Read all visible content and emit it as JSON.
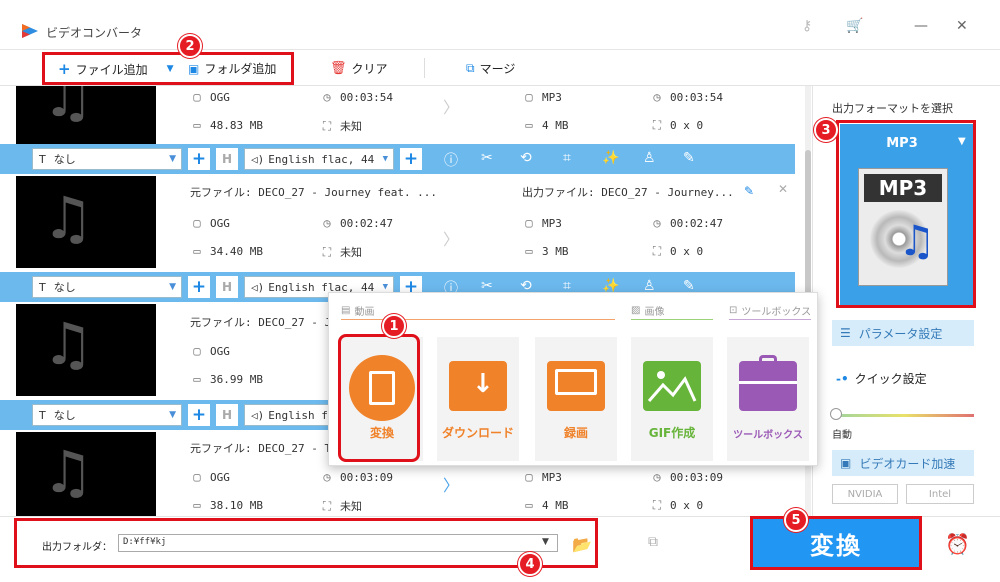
{
  "app": {
    "title": "ビデオコンバータ"
  },
  "toolbar": {
    "add_file": "ファイル追加",
    "add_folder": "フォルダ追加",
    "clear": "クリア",
    "merge": "マージ"
  },
  "files": [
    {
      "src_label": "",
      "out_label": "",
      "src_format": "OGG",
      "src_duration": "00:03:54",
      "src_size": "48.83 MB",
      "src_res": "未知",
      "out_format": "MP3",
      "out_duration": "00:03:54",
      "out_size": "4 MB",
      "out_res": "0 x 0"
    },
    {
      "src_label": "元ファイル: DECO_27 - Journey feat. ...",
      "out_label": "出力ファイル: DECO_27 - Journey...",
      "src_format": "OGG",
      "src_duration": "00:02:47",
      "src_size": "34.40 MB",
      "src_res": "未知",
      "out_format": "MP3",
      "out_duration": "00:02:47",
      "out_size": "3 MB",
      "out_res": "0 x 0"
    },
    {
      "src_label": "元ファイル: DECO_27 - Journey feat. ...",
      "src_format": "OGG",
      "src_size": "36.99 MB"
    },
    {
      "src_label": "元ファイル: DECO_27 - T",
      "src_format": "OGG",
      "src_duration": "00:03:09",
      "src_size": "38.10 MB",
      "src_res": "未知",
      "out_format": "MP3",
      "out_duration": "00:03:09",
      "out_size": "4 MB",
      "out_res": "0 x 0"
    }
  ],
  "edit_bars": [
    {
      "subtitle": "なし",
      "audio": "English flac, 44"
    },
    {
      "subtitle": "なし",
      "audio": "English flac, 44"
    },
    {
      "subtitle": "なし",
      "audio": "English fl"
    }
  ],
  "popup": {
    "cat_video": "動画",
    "cat_image": "画像",
    "cat_toolbox": "ツールボックス",
    "tiles": [
      {
        "label": "変換",
        "color": "#f0822a"
      },
      {
        "label": "ダウンロード",
        "color": "#f0822a"
      },
      {
        "label": "録画",
        "color": "#f0822a"
      },
      {
        "label": "GIF作成",
        "color": "#67b43a"
      },
      {
        "label": "ツールボックス",
        "color": "#9b59b6"
      }
    ]
  },
  "right": {
    "format_label": "出力フォーマットを選択",
    "format_name": "MP3",
    "format_tag": "MP3",
    "param_label": "パラメータ設定",
    "quick_label": "クイック設定",
    "auto_label": "自動",
    "gpu_label": "ビデオカード加速",
    "nvidia": "NVIDIA",
    "intel": "Intel"
  },
  "bottom": {
    "output_label": "出力フォルダ：",
    "output_path": "D:¥ff¥kj",
    "convert_label": "変換"
  },
  "badges": [
    "1",
    "2",
    "3",
    "4",
    "5"
  ],
  "colors": {
    "accent": "#2196f3",
    "callout": "#e0101a",
    "edit_bar": "#6cb9ee"
  }
}
